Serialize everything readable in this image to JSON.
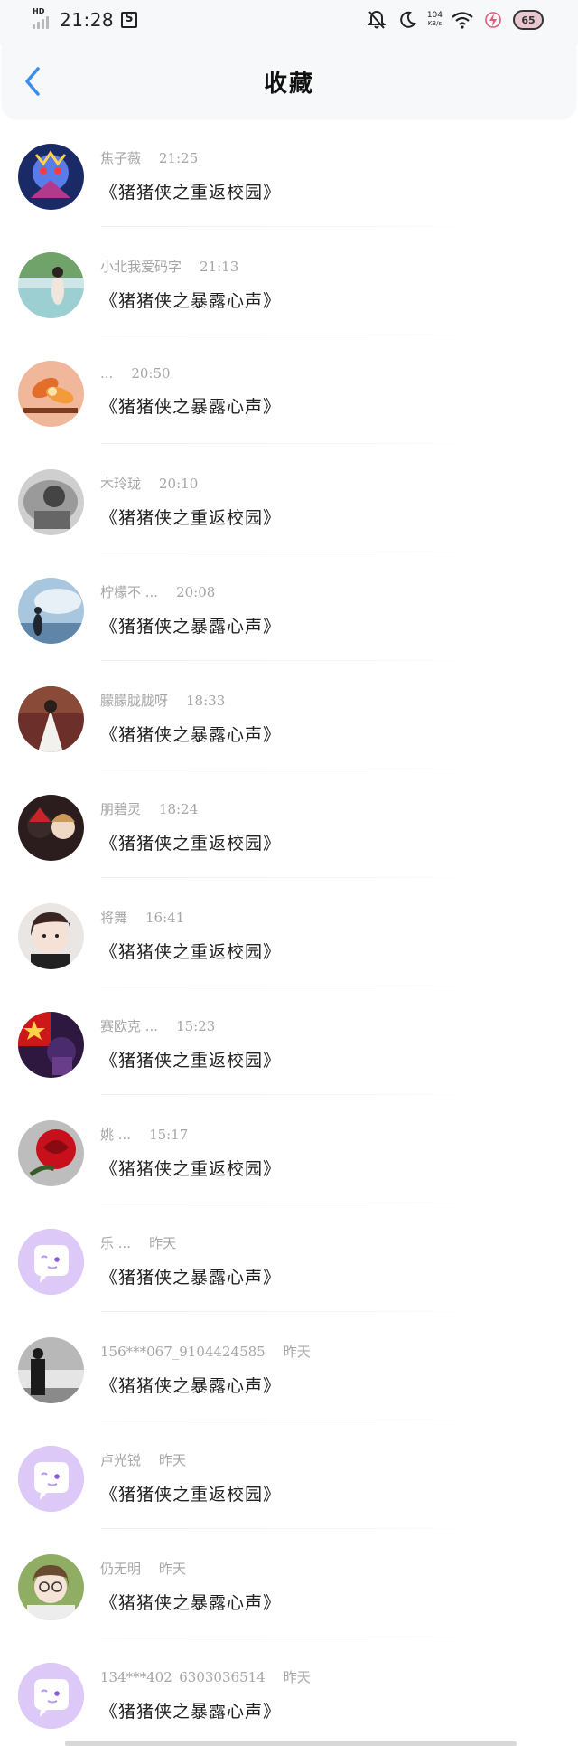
{
  "status_bar": {
    "network_tag": "HD",
    "time": "21:28",
    "speed_value": "104",
    "speed_unit": "KB/s",
    "battery_text": "65"
  },
  "header": {
    "title": "收藏"
  },
  "items": [
    {
      "name": "焦子薇",
      "time": "21:25",
      "title": "《猪猪侠之重返校园》",
      "avatar": "game-character"
    },
    {
      "name": "小北我爱码字",
      "time": "21:13",
      "title": "《猪猪侠之暴露心声》",
      "avatar": "girl-lake"
    },
    {
      "name": "...",
      "time": "20:50",
      "title": "《猪猪侠之暴露心声》",
      "avatar": "orange-flower"
    },
    {
      "name": "木玲珑",
      "time": "20:10",
      "title": "《猪猪侠之重返校园》",
      "avatar": "grey-portrait"
    },
    {
      "name": "柠檬不 ...",
      "time": "20:08",
      "title": "《猪猪侠之暴露心声》",
      "avatar": "sky-girl"
    },
    {
      "name": "朦朦胧胧呀",
      "time": "18:33",
      "title": "《猪猪侠之暴露心声》",
      "avatar": "white-robe"
    },
    {
      "name": "朋碧灵",
      "time": "18:24",
      "title": "《猪猪侠之重返校园》",
      "avatar": "anime-boys"
    },
    {
      "name": "将舞",
      "time": "16:41",
      "title": "《猪猪侠之重返校园》",
      "avatar": "girl-face"
    },
    {
      "name": "赛欧克 ...",
      "time": "15:23",
      "title": "《猪猪侠之重返校园》",
      "avatar": "red-hero"
    },
    {
      "name": "姚 ...",
      "time": "15:17",
      "title": "《猪猪侠之重返校园》",
      "avatar": "red-rose"
    },
    {
      "name": "乐 ...",
      "time": "昨天",
      "title": "《猪猪侠之暴露心声》",
      "avatar": "default-chat"
    },
    {
      "name": "156***067_9104424585",
      "time": "昨天",
      "title": "《猪猪侠之暴露心声》",
      "avatar": "car-girl"
    },
    {
      "name": "卢光锐",
      "time": "昨天",
      "title": "《猪猪侠之重返校园》",
      "avatar": "default-chat"
    },
    {
      "name": "仍无明",
      "time": "昨天",
      "title": "《猪猪侠之暴露心声》",
      "avatar": "glasses-girl"
    },
    {
      "name": "134***402_6303036514",
      "time": "昨天",
      "title": "《猪猪侠之暴露心声》",
      "avatar": "default-chat"
    }
  ],
  "colors": {
    "accent": "#3a8ef0",
    "meta_text": "#a6a6a6",
    "default_avatar_bg": "#dcc9f7"
  }
}
